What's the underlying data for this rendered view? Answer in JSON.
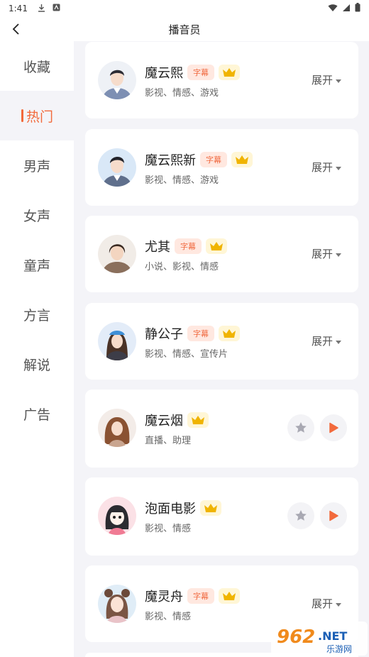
{
  "status_bar": {
    "time": "1:41"
  },
  "nav": {
    "title": "播音员"
  },
  "sidebar": {
    "items": [
      {
        "label": "收藏"
      },
      {
        "label": "热门"
      },
      {
        "label": "男声"
      },
      {
        "label": "女声"
      },
      {
        "label": "童声"
      },
      {
        "label": "方言"
      },
      {
        "label": "解说"
      },
      {
        "label": "广告"
      }
    ]
  },
  "list": {
    "expand_label": "展开",
    "subtitle_tag": "字幕",
    "items": [
      {
        "name": "魔云熙",
        "tags": "影视、情感、游戏"
      },
      {
        "name": "魔云熙新",
        "tags": "影视、情感、游戏"
      },
      {
        "name": "尤其",
        "tags": "小说、影视、情感"
      },
      {
        "name": "静公子",
        "tags": "影视、情感、宣传片"
      },
      {
        "name": "魔云烟",
        "tags": "直播、助理"
      },
      {
        "name": "泡面电影",
        "tags": "影视、情感"
      },
      {
        "name": "魔灵舟",
        "tags": "影视、情感"
      }
    ]
  },
  "watermark": {
    "brand": "962",
    "suffix": ".NET",
    "sub": "乐游网"
  },
  "colors": {
    "accent": "#f26a3c",
    "crown": "#f0b400",
    "tag_bg": "#ffe8e0"
  }
}
